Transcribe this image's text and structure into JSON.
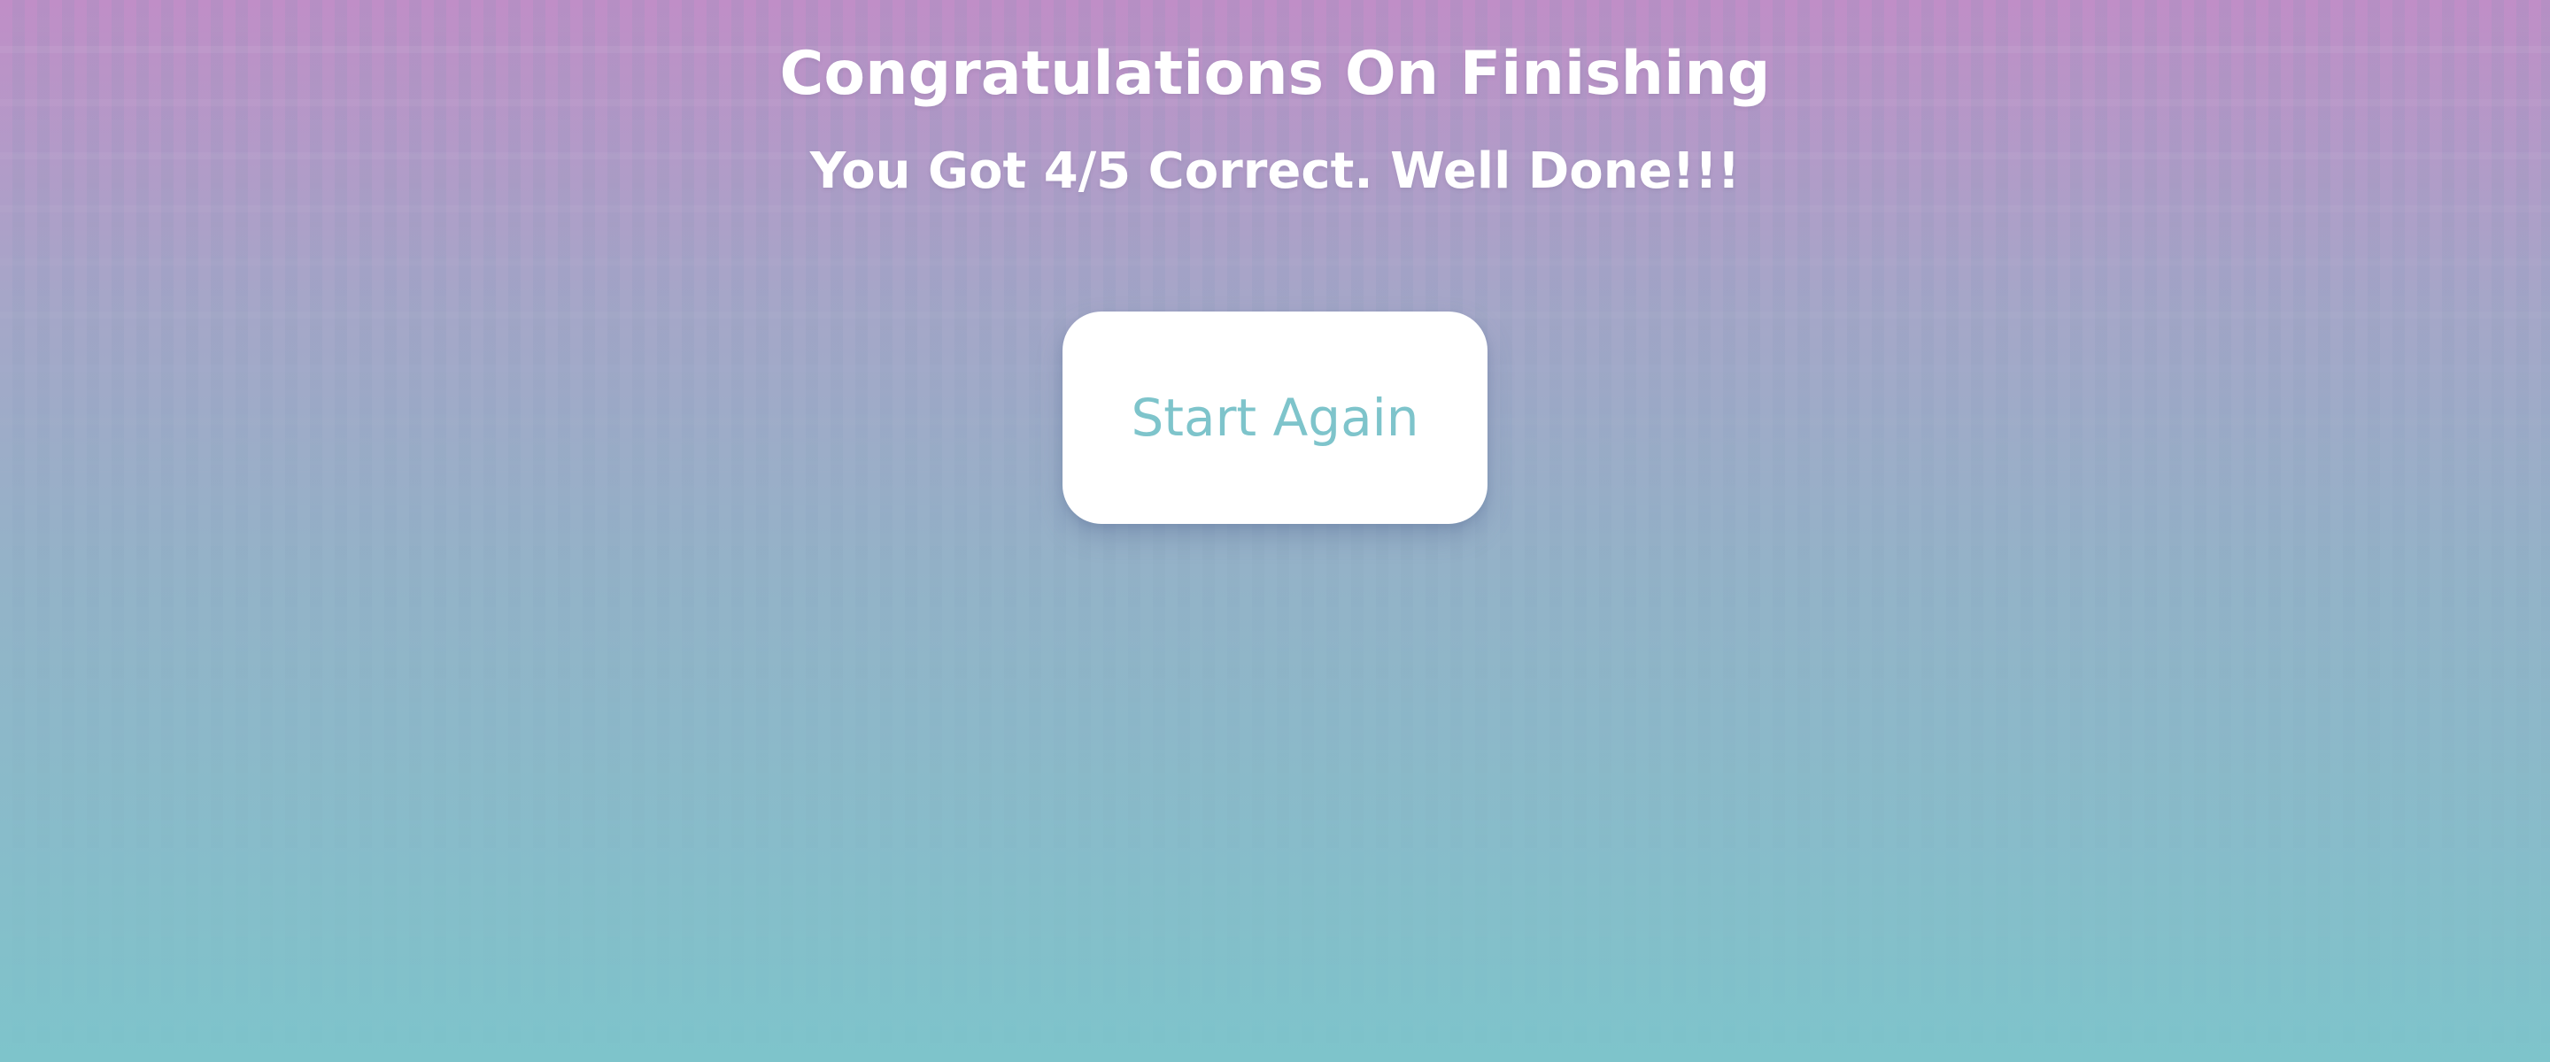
{
  "results": {
    "title": "Congratulations On Finishing",
    "score_message": "You Got 4/5 Correct. Well Done!!!",
    "restart_label": "Start Again"
  },
  "colors": {
    "gradient_top": "#c08ec7",
    "gradient_bottom": "#7ec4cb",
    "button_bg": "#ffffff",
    "button_text": "#7ec4cb",
    "heading_text": "#ffffff"
  }
}
